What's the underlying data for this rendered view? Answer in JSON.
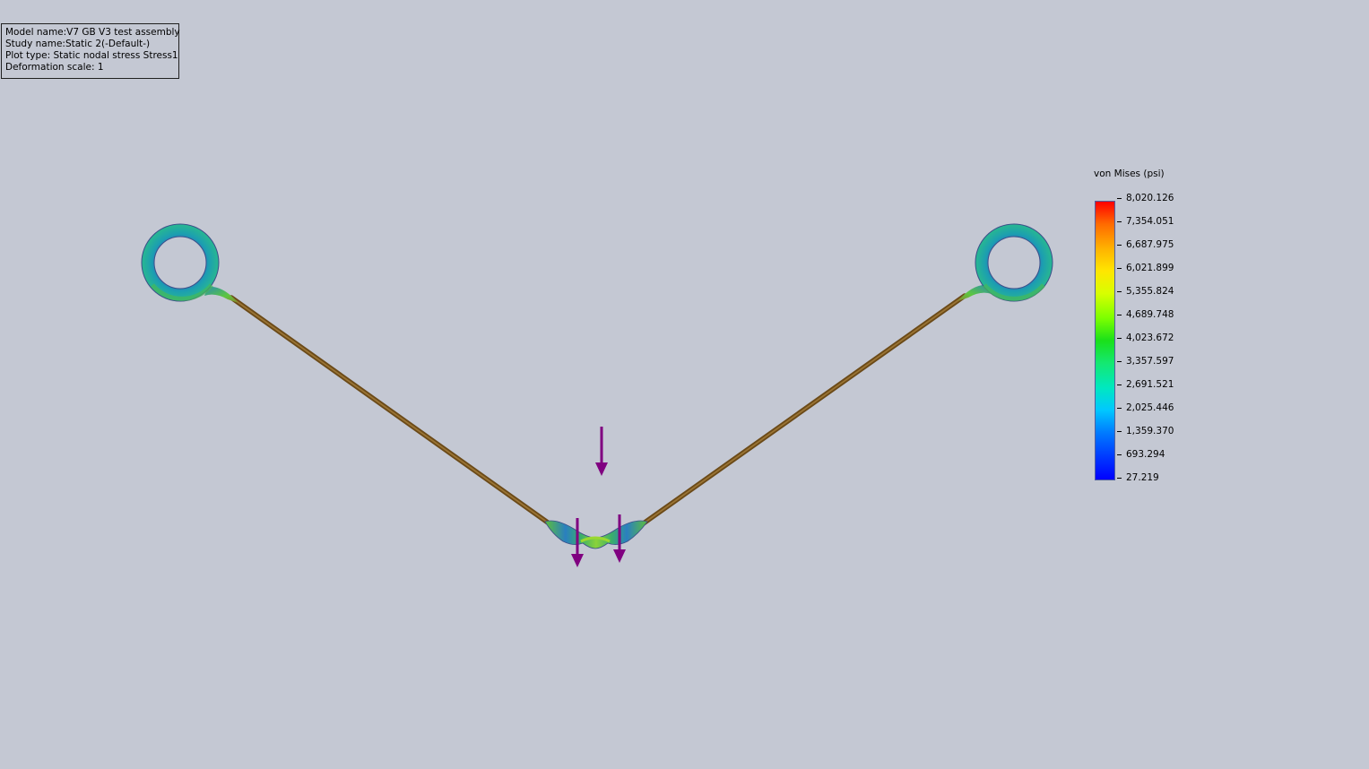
{
  "info": {
    "model_name": "Model name:V7 GB V3 test assembly",
    "study_name": "Study name:Static 2(-Default-)",
    "plot_type": "Plot type: Static nodal stress Stress1",
    "deformation_scale": "Deformation scale: 1"
  },
  "legend": {
    "title": "von Mises (psi)",
    "values": [
      "8,020.126",
      "7,354.051",
      "6,687.975",
      "6,021.899",
      "5,355.824",
      "4,689.748",
      "4,023.672",
      "3,357.597",
      "2,691.521",
      "2,025.446",
      "1,359.370",
      "693.294",
      "27.219"
    ]
  },
  "colors": {
    "background": "#c4c8d3",
    "beam": "#7a5a20",
    "arrow": "#800080",
    "ring_low": "#1f63b8",
    "ring_mid": "#27a9a0",
    "ring_high": "#49c84a"
  },
  "icons": {
    "load_arrow": "down-arrow-icon"
  }
}
